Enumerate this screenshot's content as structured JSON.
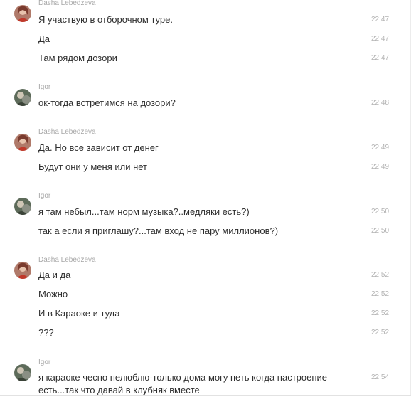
{
  "colors": {
    "author_name": "#a8a8a8",
    "message_text": "#2e2e2e",
    "timestamp": "#b3b3b3",
    "background": "#ffffff"
  },
  "groups": [
    {
      "author": "Dasha Lebedzeva",
      "avatar_icon": "user-avatar-dasha-icon",
      "messages": [
        {
          "text": "Я участвую в отборочном туре.",
          "time": "22:47"
        },
        {
          "text": "Да",
          "time": "22:47"
        },
        {
          "text": "Там рядом дозори",
          "time": "22:47"
        }
      ]
    },
    {
      "author": "Igor",
      "avatar_icon": "user-avatar-igor-icon",
      "messages": [
        {
          "text": "ок-тогда встретимся на дозори?",
          "time": "22:48"
        }
      ]
    },
    {
      "author": "Dasha Lebedzeva",
      "avatar_icon": "user-avatar-dasha-icon",
      "messages": [
        {
          "text": "Да. Но все зависит от денег",
          "time": "22:49"
        },
        {
          "text": "Будут они у меня или нет",
          "time": "22:49"
        }
      ]
    },
    {
      "author": "Igor",
      "avatar_icon": "user-avatar-igor-icon",
      "messages": [
        {
          "text": "я там небыл...там норм музыка?..медляки есть?)",
          "time": "22:50"
        },
        {
          "text": "так а если я приглашу?...там вход не пару миллионов?)",
          "time": "22:50"
        }
      ]
    },
    {
      "author": "Dasha Lebedzeva",
      "avatar_icon": "user-avatar-dasha-icon",
      "messages": [
        {
          "text": "Да и да",
          "time": "22:52"
        },
        {
          "text": "Можно",
          "time": "22:52"
        },
        {
          "text": "И в Караоке и туда",
          "time": "22:52"
        },
        {
          "text": "???",
          "time": "22:52"
        }
      ]
    },
    {
      "author": "Igor",
      "avatar_icon": "user-avatar-igor-icon",
      "messages": [
        {
          "text": "я караоке чесно нелюблю-только дома могу петь когда настроение есть...так что давай в клубняк вместе",
          "time": "22:54"
        }
      ]
    }
  ]
}
